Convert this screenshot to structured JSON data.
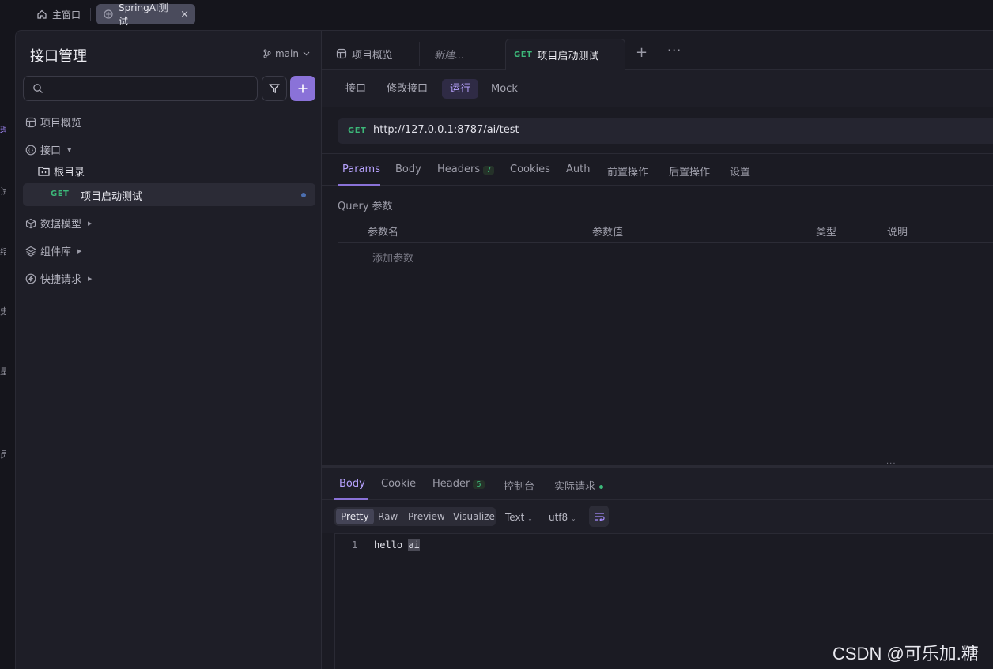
{
  "window_tabs": {
    "home": "主窗口",
    "active": "SpringAI测试",
    "close": "×"
  },
  "rail_glyphs": [
    "理",
    "试",
    "结",
    "史",
    "量",
    "员"
  ],
  "sidebar": {
    "title": "接口管理",
    "branch": "main",
    "search": {
      "placeholder": "",
      "value": ""
    },
    "nav": {
      "overview": "项目概览",
      "api": "接口",
      "root": "根目录",
      "item_method": "GET",
      "item_label": "项目启动测试",
      "data_model": "数据模型",
      "components": "组件库",
      "quick_request": "快捷请求"
    }
  },
  "doc_tabs": {
    "overview": "项目概览",
    "new": "新建...",
    "active_method": "GET",
    "active_label": "项目启动测试",
    "add": "+",
    "more": "···"
  },
  "modes": [
    "接口",
    "修改接口",
    "运行",
    "Mock"
  ],
  "request": {
    "method": "GET",
    "url": "http://127.0.0.1:8787/ai/test"
  },
  "request_tabs": {
    "params": "Params",
    "body": "Body",
    "headers": "Headers",
    "headers_count": "7",
    "cookies": "Cookies",
    "auth": "Auth",
    "pre": "前置操作",
    "post": "后置操作",
    "settings": "设置"
  },
  "query": {
    "title": "Query 参数",
    "columns": [
      "参数名",
      "参数值",
      "类型",
      "说明"
    ],
    "add_placeholder": "添加参数"
  },
  "splitter_dots": "···",
  "response_tabs": {
    "body": "Body",
    "cookie": "Cookie",
    "header": "Header",
    "header_count": "5",
    "console": "控制台",
    "actual": "实际请求"
  },
  "view": {
    "modes": [
      "Pretty",
      "Raw",
      "Preview",
      "Visualize"
    ],
    "format": "Text",
    "encoding": "utf8"
  },
  "response_body": {
    "line_number": "1",
    "text_a": "hello ",
    "text_b": "ai"
  },
  "watermark": "CSDN @可乐加.糖",
  "colors": {
    "accent": "#8a72d8",
    "get_green": "#3cb879",
    "background": "#1b1b23"
  }
}
